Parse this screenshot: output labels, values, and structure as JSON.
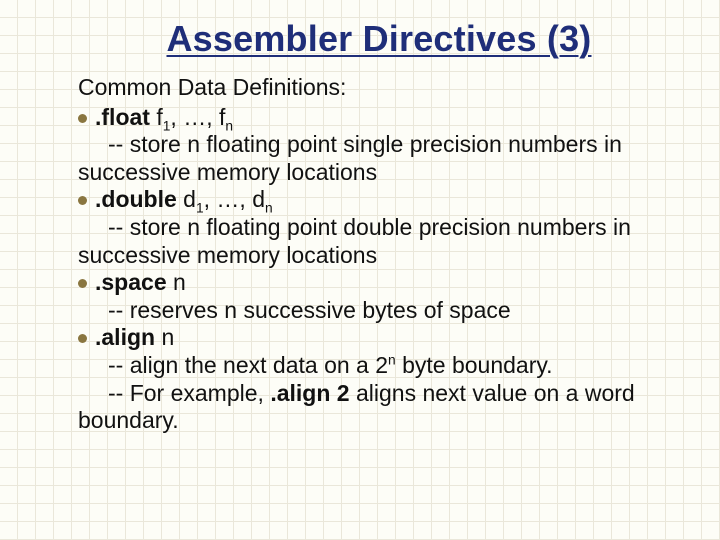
{
  "title": "Assembler Directives (3)",
  "intro": "Common Data Definitions:",
  "items": [
    {
      "directive": ".float",
      "arg_prefix": " f",
      "arg_sub1": "1",
      "arg_mid": ", …, f",
      "arg_subn": "n",
      "desc": [
        "-- store n floating point single precision numbers in",
        "successive memory locations"
      ],
      "plain_arg": ""
    },
    {
      "directive": ".double",
      "arg_prefix": " d",
      "arg_sub1": "1",
      "arg_mid": ", …, d",
      "arg_subn": "n",
      "desc": [
        "-- store n floating point double precision numbers in",
        "successive memory locations"
      ],
      "plain_arg": ""
    },
    {
      "directive": ".space",
      "plain_arg": " n",
      "arg_prefix": "",
      "arg_sub1": "",
      "arg_mid": "",
      "arg_subn": "",
      "desc": [
        "-- reserves n successive bytes of space"
      ]
    },
    {
      "directive": ".align",
      "plain_arg": " n",
      "arg_prefix": "",
      "arg_sub1": "",
      "arg_mid": "",
      "arg_subn": "",
      "align_line_pre": "-- align the next data on a 2",
      "align_sup": "n",
      "align_line_post": " byte boundary.",
      "example_pre": "-- For example, ",
      "example_bold": ".align 2",
      "example_post": " aligns next value on a word",
      "example_tail": "boundary.",
      "desc": []
    }
  ]
}
